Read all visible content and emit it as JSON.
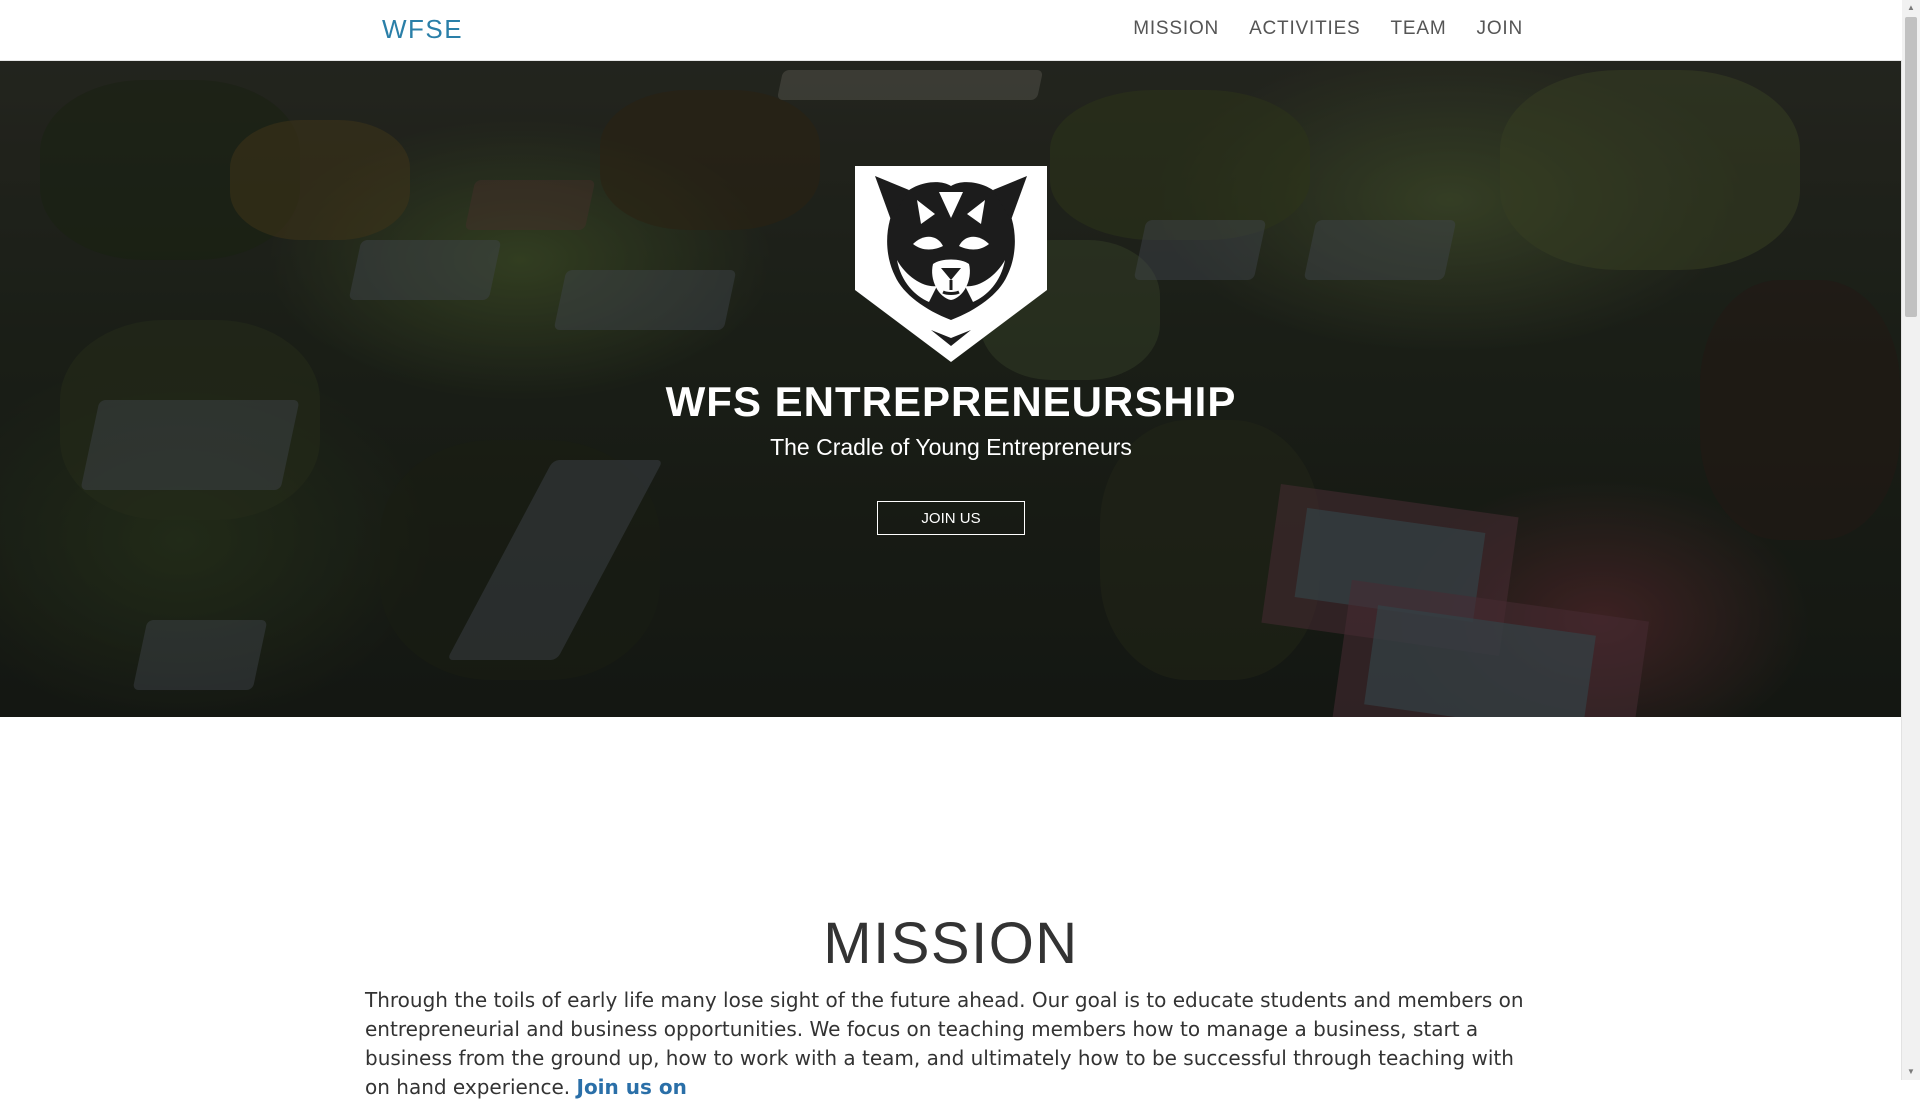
{
  "nav": {
    "brand": "WFSE",
    "links": [
      "MISSION",
      "ACTIVITIES",
      "TEAM",
      "JOIN"
    ]
  },
  "hero": {
    "logo_icon": "tiger-shield-logo",
    "title": "WFS ENTREPRENEURSHIP",
    "subtitle": "The Cradle of Young Entrepreneurs",
    "button_label": "JOIN US"
  },
  "mission": {
    "title": "MISSION",
    "body": "Through the toils of early life many lose sight of the future ahead. Our goal is to educate students and members on entrepreneurial and business opportunities. We focus on teaching members how to manage a business, start a business from the ground up, how to work with a team, and ultimately how to be successful through teaching with on hand experience. ",
    "link_text": "Join us on"
  },
  "colors": {
    "brand": "#2a7fa8",
    "link": "#2a6fa8",
    "nav_text": "#555555",
    "heading": "#333333"
  }
}
